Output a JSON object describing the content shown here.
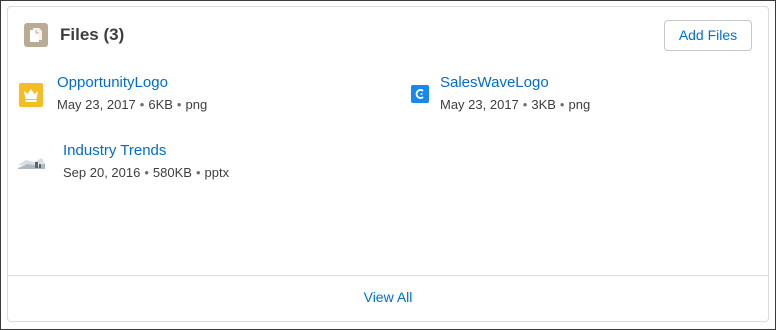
{
  "card": {
    "title": "Files (3)",
    "icon": "files-icon",
    "add_button_label": "Add Files",
    "view_all_label": "View All"
  },
  "files": [
    {
      "name": "OpportunityLogo",
      "date": "May 23, 2017",
      "size": "6KB",
      "type": "png",
      "icon": "crown-thumbnail-icon"
    },
    {
      "name": "SalesWaveLogo",
      "date": "May 23, 2017",
      "size": "3KB",
      "type": "png",
      "icon": "saleswave-logo-thumbnail-icon"
    },
    {
      "name": "Industry Trends",
      "date": "Sep 20, 2016",
      "size": "580KB",
      "type": "pptx",
      "icon": "slide-thumbnail-icon"
    }
  ],
  "colors": {
    "link": "#006dcc",
    "icon_bg": "#baac93",
    "crown_bg": "#f4bc25",
    "saleswave_bg": "#1589ee"
  }
}
